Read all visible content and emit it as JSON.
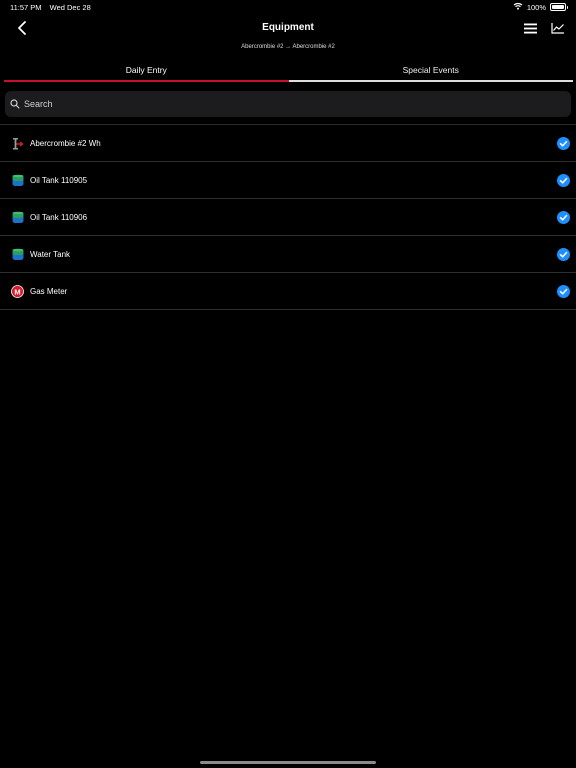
{
  "status_bar": {
    "time": "11:57 PM",
    "date": "Wed Dec 28",
    "battery": "100%",
    "battery_level": 1.0
  },
  "nav": {
    "title": "Equipment",
    "back_icon": "chevron-left-icon",
    "menu_icon": "list-icon",
    "chart_icon": "line-chart-icon"
  },
  "breadcrumb": "Abercrombie #2 → Abercrombie #2",
  "tabs": [
    {
      "label": "Daily Entry",
      "active": true
    },
    {
      "label": "Special Events",
      "active": false
    }
  ],
  "search": {
    "placeholder": "Search",
    "value": ""
  },
  "colors": {
    "accent_red": "#c8102e",
    "check_blue": "#1e8fff",
    "tank_green": "#2e9e5e",
    "tank_blue": "#1a73c8",
    "meter_red": "#d81e2c"
  },
  "equipment": [
    {
      "label": "Abercrombie #2 Wh",
      "icon": "wellhead-icon",
      "checked": true
    },
    {
      "label": "Oil Tank 110905",
      "icon": "tank-icon",
      "checked": true
    },
    {
      "label": "Oil Tank 110906",
      "icon": "tank-icon",
      "checked": true
    },
    {
      "label": "Water Tank",
      "icon": "tank-icon",
      "checked": true
    },
    {
      "label": "Gas Meter",
      "icon": "meter-icon",
      "checked": true,
      "icon_text": "M"
    }
  ]
}
